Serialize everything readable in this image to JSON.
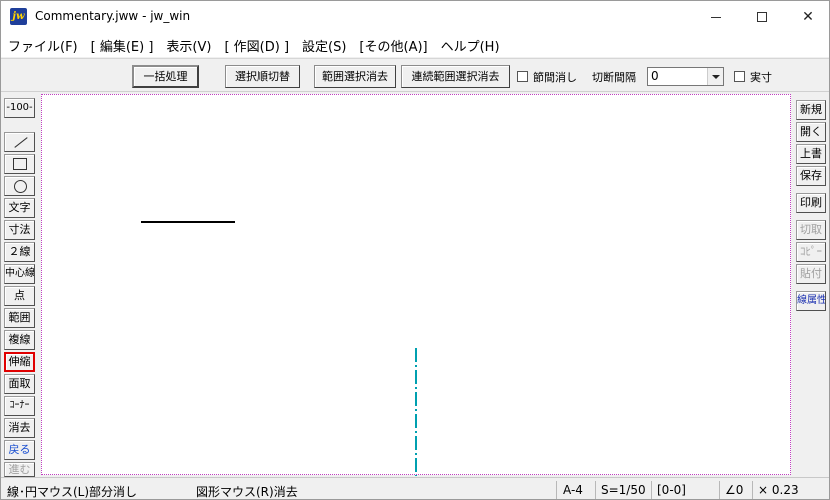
{
  "window": {
    "title": "Commentary.jww - jw_win",
    "app_icon_text": "jw"
  },
  "menu": [
    "ファイル(F)",
    "[ 編集(E) ]",
    "表示(V)",
    "[ 作図(D) ]",
    "設定(S)",
    "[その他(A)]",
    "ヘルプ(H)"
  ],
  "toolbar": {
    "batch_process": "一括処理",
    "toggle_selection_order": "選択順切替",
    "range_select_erase": "範囲選択消去",
    "continuous_range_erase": "連続範囲選択消去",
    "partial_erase_label": "節間消し",
    "cut_interval_label": "切断間隔",
    "cut_interval_value": "0",
    "actual_size_label": "実寸"
  },
  "left_tools": {
    "scale": "-100-",
    "text": "文字",
    "dimension": "寸法",
    "double_line": "２線",
    "center_line": "中心線",
    "point": "点",
    "range": "範囲",
    "multi_line": "複線",
    "stretch": "伸縮",
    "chamfer": "面取",
    "corner": "ｺｰﾅｰ",
    "erase": "消去",
    "undo": "戻る",
    "redo": "進む"
  },
  "right_tools": {
    "new": "新規",
    "open": "開く",
    "overwrite": "上書",
    "save": "保存",
    "print": "印刷",
    "cut": "切取",
    "copy": "ｺﾋﾟｰ",
    "paste": "貼付",
    "line_attr": "線属性"
  },
  "status": {
    "left_hint": "線･円マウス(L)部分消し",
    "right_hint": "図形マウス(R)消去",
    "paper": "A-4",
    "scale": "S=1/50",
    "layer": "[0-0]",
    "angle": "∠0",
    "zoom": "× 0.23"
  },
  "colors": {
    "active_border": "#e00000",
    "canvas_border": "#c040c0",
    "center_line": "#00a0b0",
    "undo_text": "#1a4fd0"
  }
}
